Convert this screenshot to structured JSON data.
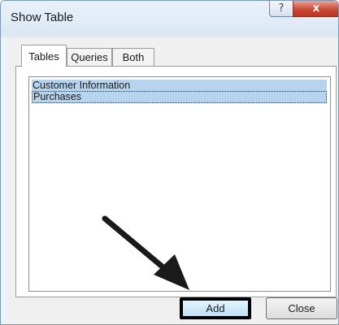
{
  "window": {
    "title": "Show Table",
    "help_glyph": "?",
    "close_glyph": "x"
  },
  "tabs": [
    {
      "label": "Tables",
      "active": true
    },
    {
      "label": "Queries",
      "active": false
    },
    {
      "label": "Both",
      "active": false
    }
  ],
  "list": {
    "items": [
      {
        "label": "Customer Information",
        "selected": true
      },
      {
        "label": "Purchases",
        "selected": true
      }
    ]
  },
  "buttons": {
    "add_label": "Add",
    "close_label": "Close"
  },
  "annotation": {
    "arrow_color": "#1a1a1a",
    "highlight_color": "#000000",
    "selection_color": "#b7d4ef"
  }
}
